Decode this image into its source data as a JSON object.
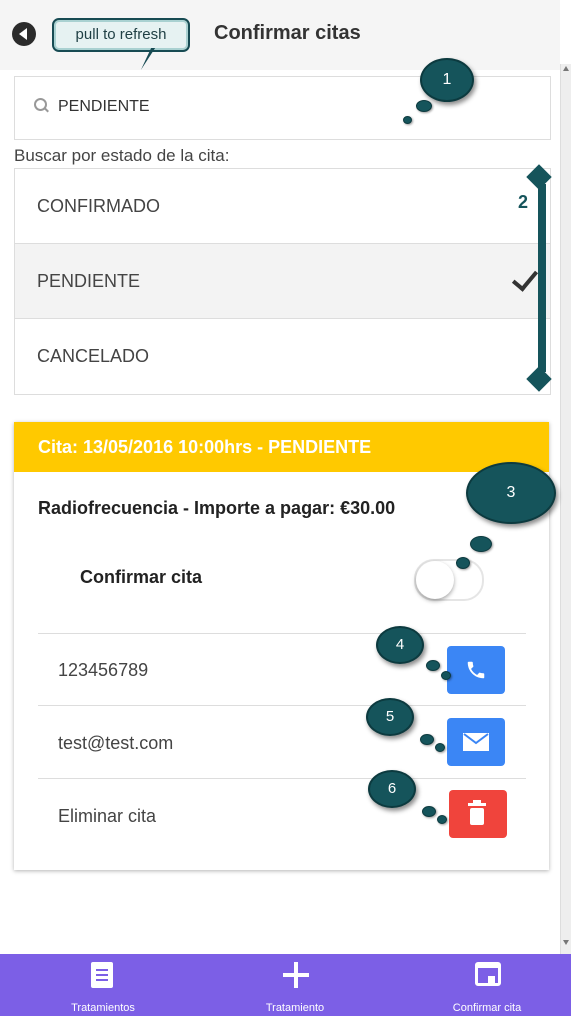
{
  "header": {
    "title": "Confirmar citas",
    "refresh_tip": "pull to refresh"
  },
  "search": {
    "value": "PENDIENTE"
  },
  "filter": {
    "label": "Buscar por estado de la cita:",
    "options": [
      "CONFIRMADO",
      "PENDIENTE",
      "CANCELADO"
    ],
    "selected": "PENDIENTE"
  },
  "callouts": [
    "1",
    "2",
    "3",
    "4",
    "5",
    "6"
  ],
  "appointment": {
    "header": "Cita: 13/05/2016 10:00hrs - PENDIENTE",
    "treatment": "Radiofrecuencia - Importe a pagar: €30.00",
    "confirm_label": "Confirmar cita",
    "confirmed": false,
    "phone": "123456789",
    "email": "test@test.com",
    "delete_label": "Eliminar cita",
    "header_color": "#ffc900"
  },
  "nav": {
    "items": [
      "Tratamientos",
      "Tratamiento",
      "Confirmar cita"
    ],
    "bg_color": "#7c5fe6"
  }
}
